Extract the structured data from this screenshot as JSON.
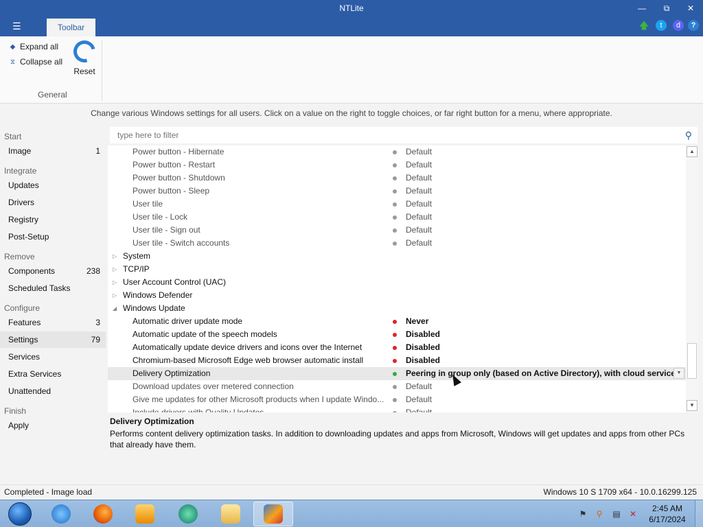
{
  "window": {
    "title": "NTLite",
    "menu_icon": "hamburger-icon",
    "tab": "Toolbar",
    "controls": [
      "minimize-icon",
      "restore-icon",
      "close-icon"
    ],
    "top_icons": [
      "update-arrow-icon",
      "twitter-icon",
      "discord-icon",
      "help-icon"
    ]
  },
  "ribbon": {
    "expand_all": "Expand all",
    "collapse_all": "Collapse all",
    "reset": "Reset",
    "group_label": "General"
  },
  "hint": "Change various Windows settings for all users. Click on a value on the right to toggle choices, or far right button for a menu, where appropriate.",
  "sidebar": {
    "sections": [
      {
        "label": "Start",
        "items": [
          {
            "label": "Image",
            "count": "1"
          }
        ]
      },
      {
        "label": "Integrate",
        "items": [
          {
            "label": "Updates",
            "count": ""
          },
          {
            "label": "Drivers",
            "count": ""
          },
          {
            "label": "Registry",
            "count": ""
          },
          {
            "label": "Post-Setup",
            "count": ""
          }
        ]
      },
      {
        "label": "Remove",
        "items": [
          {
            "label": "Components",
            "count": "238"
          },
          {
            "label": "Scheduled Tasks",
            "count": ""
          }
        ]
      },
      {
        "label": "Configure",
        "items": [
          {
            "label": "Features",
            "count": "3"
          },
          {
            "label": "Settings",
            "count": "79",
            "active": true
          },
          {
            "label": "Services",
            "count": ""
          },
          {
            "label": "Extra Services",
            "count": ""
          },
          {
            "label": "Unattended",
            "count": ""
          }
        ]
      },
      {
        "label": "Finish",
        "items": [
          {
            "label": "Apply",
            "count": ""
          }
        ]
      }
    ]
  },
  "filter": {
    "placeholder": "type here to filter"
  },
  "rows": [
    {
      "kind": "item",
      "name": "Power button - Hibernate",
      "value": "Default",
      "status": "default"
    },
    {
      "kind": "item",
      "name": "Power button - Restart",
      "value": "Default",
      "status": "default"
    },
    {
      "kind": "item",
      "name": "Power button - Shutdown",
      "value": "Default",
      "status": "default"
    },
    {
      "kind": "item",
      "name": "Power button - Sleep",
      "value": "Default",
      "status": "default"
    },
    {
      "kind": "item",
      "name": "User tile",
      "value": "Default",
      "status": "default"
    },
    {
      "kind": "item",
      "name": "User tile - Lock",
      "value": "Default",
      "status": "default"
    },
    {
      "kind": "item",
      "name": "User tile - Sign out",
      "value": "Default",
      "status": "default"
    },
    {
      "kind": "item",
      "name": "User tile - Switch accounts",
      "value": "Default",
      "status": "default"
    },
    {
      "kind": "cat",
      "name": "System",
      "expanded": false
    },
    {
      "kind": "cat",
      "name": "TCP/IP",
      "expanded": false
    },
    {
      "kind": "cat",
      "name": "User Account Control (UAC)",
      "expanded": false
    },
    {
      "kind": "cat",
      "name": "Windows Defender",
      "expanded": false
    },
    {
      "kind": "cat",
      "name": "Windows Update",
      "expanded": true
    },
    {
      "kind": "item",
      "name": "Automatic driver update mode",
      "value": "Never",
      "status": "changed"
    },
    {
      "kind": "item",
      "name": "Automatic update of the speech models",
      "value": "Disabled",
      "status": "changed"
    },
    {
      "kind": "item",
      "name": "Automatically update device drivers and icons over the Internet",
      "value": "Disabled",
      "status": "changed"
    },
    {
      "kind": "item",
      "name": "Chromium-based Microsoft Edge web browser automatic install",
      "value": "Disabled",
      "status": "changed"
    },
    {
      "kind": "item",
      "name": "Delivery Optimization",
      "value": "Peering in group only (based on Active Directory), with cloud service",
      "status": "enabled",
      "selected": true,
      "menu": true
    },
    {
      "kind": "item",
      "name": "Download updates over metered connection",
      "value": "Default",
      "status": "default"
    },
    {
      "kind": "item",
      "name": "Give me updates for other Microsoft products when I update Windo...",
      "value": "Default",
      "status": "default"
    },
    {
      "kind": "item",
      "name": "Include drivers with Quality Updates",
      "value": "Default",
      "status": "default"
    }
  ],
  "status_colors": {
    "default": "#9a9a9a",
    "changed": "#e0242b",
    "enabled": "#2fae3a"
  },
  "description": {
    "title": "Delivery Optimization",
    "text": "Performs content delivery optimization tasks. In addition to downloading updates and apps from Microsoft, Windows will get updates and apps from other PCs that already have them."
  },
  "statusbar": {
    "left": "Completed - Image load",
    "right": "Windows 10 S 1709 x64 - 10.0.16299.125"
  },
  "taskbar": {
    "apps": [
      "start-orb-icon",
      "internet-explorer-icon",
      "firefox-icon",
      "media-player-icon",
      "browser-app-icon",
      "file-explorer-icon",
      "ntlite-icon"
    ],
    "tray": [
      "flag-icon",
      "search-tray-icon",
      "network-icon",
      "volume-muted-icon"
    ],
    "time": "2:45 AM",
    "date": "6/17/2024"
  }
}
